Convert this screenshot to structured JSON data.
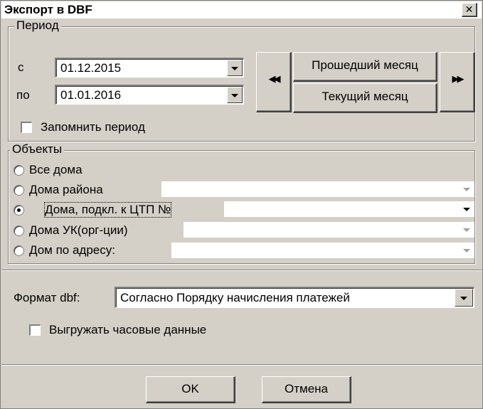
{
  "window": {
    "title": "Экспорт в DBF",
    "close_glyph": "✕"
  },
  "period": {
    "legend": "Период",
    "from_label": "с",
    "from_value": "01.12.2015",
    "to_label": "по",
    "to_value": "01.01.2016",
    "prev_glyph": "◀◀",
    "next_glyph": "▶▶",
    "last_month_label": "Прошедший месяц",
    "current_month_label": "Текущий месяц",
    "remember_label": "Запомнить период",
    "remember_checked": false
  },
  "objects": {
    "legend": "Объекты",
    "options": [
      {
        "label": "Все дома",
        "selected": false,
        "has_combo": false
      },
      {
        "label": "Дома района",
        "selected": false,
        "has_combo": true,
        "combo_enabled": false,
        "combo_value": ""
      },
      {
        "label": "Дома, подкл. к ЦТП №",
        "selected": true,
        "has_combo": true,
        "combo_enabled": true,
        "combo_value": ""
      },
      {
        "label": "Дома УК(орг-ции)",
        "selected": false,
        "has_combo": true,
        "combo_enabled": false,
        "combo_value": ""
      },
      {
        "label": "Дом по адресу:",
        "selected": false,
        "has_combo": true,
        "combo_enabled": false,
        "combo_value": ""
      }
    ]
  },
  "format": {
    "label": "Формат dbf:",
    "value": "Согласно Порядку начисления платежей",
    "hourly_label": "Выгружать часовые данные",
    "hourly_checked": false
  },
  "buttons": {
    "ok": "OK",
    "cancel": "Отмена"
  }
}
